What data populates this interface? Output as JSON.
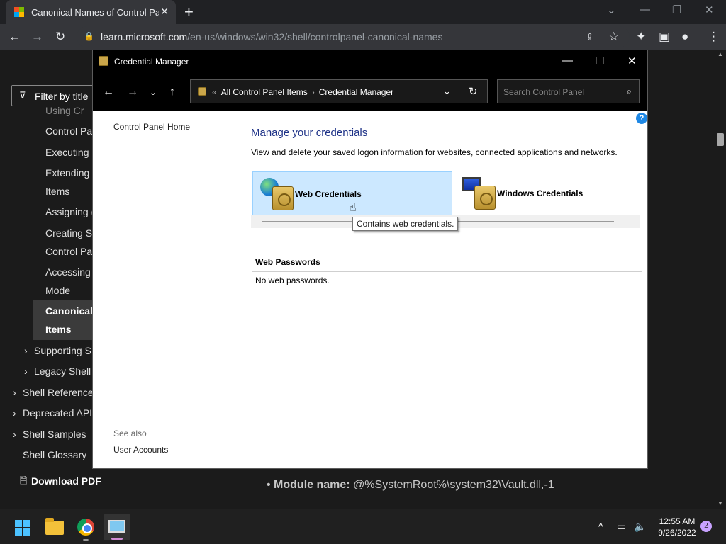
{
  "browser": {
    "tab_title": "Canonical Names of Control Panel",
    "url_host": "learn.microsoft.com",
    "url_path": "/en-us/windows/win32/shell/controlpanel-canonical-names"
  },
  "docs": {
    "filter_placeholder": "Filter by title",
    "nav_items": [
      "Using Cr",
      "Control Pa",
      "Executing C",
      "Extending",
      "Items",
      "Assigning (",
      "Creating S",
      "Control Pa",
      "Accessing",
      "Mode",
      "Canonical",
      "Items",
      "Supporting S",
      "Legacy Shell",
      "Shell Reference",
      "Deprecated API",
      "Shell Samples",
      "Shell Glossary"
    ],
    "download_pdf": "Download PDF",
    "module_label": "Module name:",
    "module_value": "@%SystemRoot%\\system32\\Vault.dll,-1"
  },
  "credential_manager": {
    "window_title": "Credential Manager",
    "breadcrumb_root": "All Control Panel Items",
    "breadcrumb_current": "Credential Manager",
    "search_placeholder": "Search Control Panel",
    "sidebar_home": "Control Panel Home",
    "see_also": "See also",
    "user_accounts": "User Accounts",
    "heading": "Manage your credentials",
    "description": "View and delete your saved logon information for websites, connected applications and networks.",
    "web_credentials": "Web Credentials",
    "windows_credentials": "Windows Credentials",
    "tooltip": "Contains web credentials.",
    "web_passwords_heading": "Web Passwords",
    "web_passwords_empty": "No web passwords.",
    "help": "?"
  },
  "taskbar": {
    "time": "12:55 AM",
    "date": "9/26/2022",
    "notifications": "2"
  },
  "icons": {
    "back": "arrow-left-icon",
    "forward": "arrow-right-icon",
    "reload": "reload-icon",
    "up": "arrow-up-icon",
    "search": "search-icon",
    "lock": "lock-icon"
  }
}
